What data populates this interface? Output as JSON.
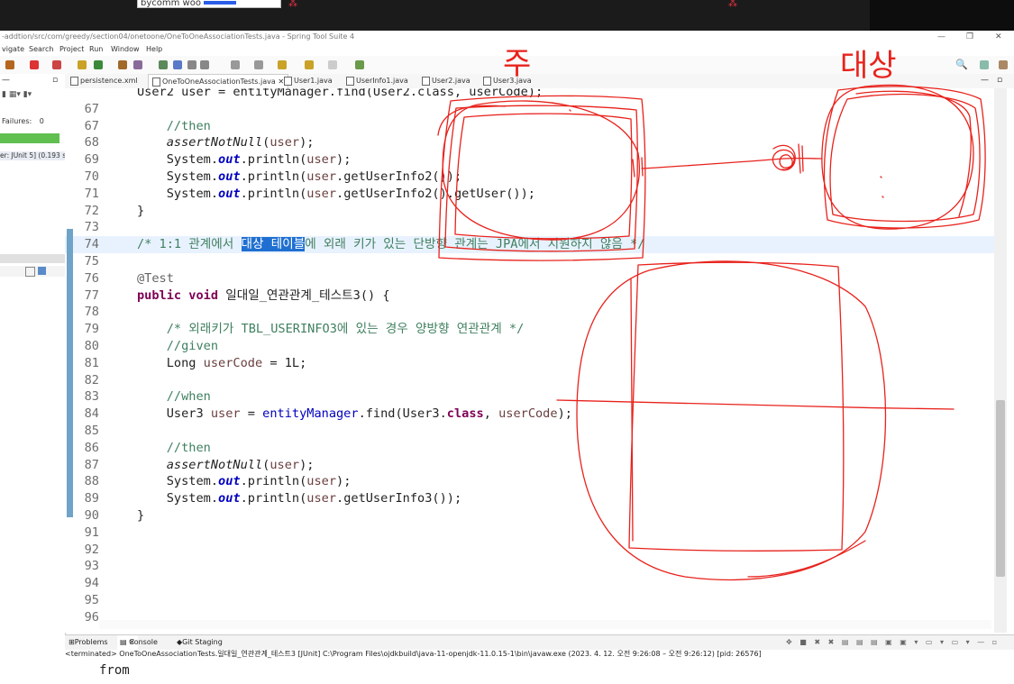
{
  "top_bar": {
    "cells": [
      "",
      "bycomm woo",
      "",
      "",
      "",
      ""
    ],
    "input_value": "bycomm woo"
  },
  "window": {
    "title": "-addtion/src/com/greedy/section04/onetoone/OneToOneAssociationTests.java - Spring Tool Suite 4"
  },
  "menu": [
    "vigate",
    "Search",
    "Project",
    "Run",
    "Window",
    "Help"
  ],
  "junit_panel": {
    "failures_label": "Failures:",
    "failures_value": "0",
    "tree_item": "er: JUnit 5] (0.193 s)"
  },
  "tabs": [
    {
      "label": "persistence.xml",
      "active": false
    },
    {
      "label": "OneToOneAssociationTests.java",
      "active": true
    },
    {
      "label": "User1.java",
      "active": false
    },
    {
      "label": "UserInfo1.java",
      "active": false
    },
    {
      "label": "User2.java",
      "active": false
    },
    {
      "label": "User3.java",
      "active": false
    }
  ],
  "code_lines": [
    {
      "n": "",
      "html": "<span>User2 user = entityManager.find(User2.class, userCode);</span>"
    },
    {
      "n": "67",
      "html": ""
    },
    {
      "n": "67",
      "html": "    <span class='cm'>//then</span>"
    },
    {
      "n": "68",
      "html": "    <span class='fn'>assertNotNull</span>(<span class='loc'>user</span>);"
    },
    {
      "n": "69",
      "html": "    System.<span class='fld'>out</span>.println(<span class='loc'>user</span>);"
    },
    {
      "n": "70",
      "html": "    System.<span class='fld'>out</span>.println(<span class='loc'>user</span>.getUserInfo2());"
    },
    {
      "n": "71",
      "html": "    System.<span class='fld'>out</span>.println(<span class='loc'>user</span>.getUserInfo2().getUser());"
    },
    {
      "n": "72",
      "html": "}"
    },
    {
      "n": "73",
      "html": ""
    },
    {
      "n": "74",
      "html": "<span class='cm'>/* 1:1 관계에서 <span class='sel'>대상 테이블</span>에 외래 키가 있는 단방향 관계는 JPA에서 지원하지 않음 */</span>"
    },
    {
      "n": "75",
      "html": ""
    },
    {
      "n": "76",
      "html": "<span class='an'>@Test</span>"
    },
    {
      "n": "77",
      "html": "<span class='kw'>public void</span> 일대일_연관관계_테스트3() {"
    },
    {
      "n": "78",
      "html": ""
    },
    {
      "n": "79",
      "html": "    <span class='cm'>/* 외래키가 TBL_USERINFO3에 있는 경우 양방향 연관관계 */</span>"
    },
    {
      "n": "80",
      "html": "    <span class='cm'>//given</span>"
    },
    {
      "n": "81",
      "html": "    Long <span class='loc'>userCode</span> = 1L;"
    },
    {
      "n": "82",
      "html": ""
    },
    {
      "n": "83",
      "html": "    <span class='cm'>//when</span>"
    },
    {
      "n": "84",
      "html": "    User3 <span class='loc'>user</span> = <span class='fld' style='font-weight:normal;font-style:normal'>entityManager</span>.find(User3.<span class='kw'>class</span>, <span class='loc'>userCode</span>);"
    },
    {
      "n": "85",
      "html": ""
    },
    {
      "n": "86",
      "html": "    <span class='cm'>//then</span>"
    },
    {
      "n": "87",
      "html": "    <span class='fn'>assertNotNull</span>(<span class='loc'>user</span>);"
    },
    {
      "n": "88",
      "html": "    System.<span class='fld'>out</span>.println(<span class='loc'>user</span>);"
    },
    {
      "n": "89",
      "html": "    System.<span class='fld'>out</span>.println(<span class='loc'>user</span>.getUserInfo3());"
    },
    {
      "n": "90",
      "html": "}"
    },
    {
      "n": "91",
      "html": ""
    },
    {
      "n": "92",
      "html": ""
    },
    {
      "n": "93",
      "html": ""
    },
    {
      "n": "94",
      "html": ""
    },
    {
      "n": "95",
      "html": ""
    },
    {
      "n": "96",
      "html": ""
    }
  ],
  "bottom_tabs": [
    "Problems",
    "Console",
    "Git Staging"
  ],
  "console": {
    "terminated": "<terminated> OneToOneAssociationTests.일대일_연관관계_테스트3 [JUnit] C:\\Program Files\\ojdkbuild\\java-11-openjdk-11.0.15-1\\bin\\javaw.exe  (2023. 4. 12. 오전 9:26:08 – 오전 9:26:12) [pid: 26576]",
    "line1": "from",
    "line2": ""
  },
  "annotations": {
    "label_main": "주",
    "label_target": "대상"
  }
}
